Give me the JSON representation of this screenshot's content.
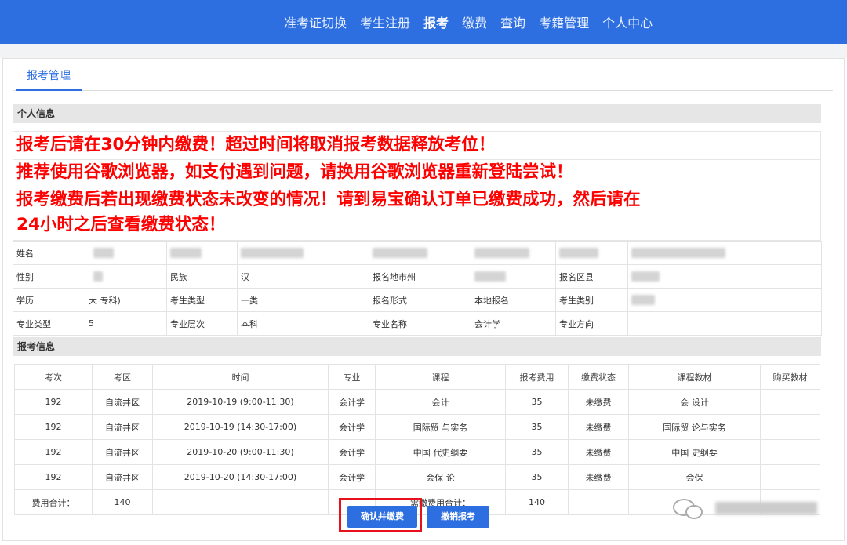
{
  "nav": {
    "items": [
      {
        "label": "准考证切换",
        "active": false
      },
      {
        "label": "考生注册",
        "active": false
      },
      {
        "label": "报考",
        "active": true
      },
      {
        "label": "缴费",
        "active": false
      },
      {
        "label": "查询",
        "active": false
      },
      {
        "label": "考籍管理",
        "active": false
      },
      {
        "label": "个人中心",
        "active": false
      }
    ]
  },
  "tab": {
    "label": "报考管理"
  },
  "personal": {
    "section_title": "个人信息",
    "notice": [
      "报考后请在30分钟内缴费！超过时间将取消报考数据释放考位！",
      "推荐使用谷歌浏览器，如支付遇到问题，请换用谷歌浏览器重新登陆尝试！",
      "报考缴费后若出现缴费状态未改变的情况！请到易宝确认订单已缴费成功，然后请在",
      "24小时之后查看缴费状态！"
    ],
    "fields": {
      "name_label": "姓名",
      "gender_label": "性别",
      "ethnicity_label": "民族",
      "ethnicity_value": "汉",
      "city_label": "报名地市州",
      "district_label": "报名区县",
      "education_label": "学历",
      "education_value": "大   专科)",
      "candidate_type_label": "考生类型",
      "candidate_type_value": "一类",
      "form_label": "报名形式",
      "form_value": "本地报名",
      "candidate_category_label": "考生类别",
      "major_type_label": "专业类型",
      "major_type_value": "5",
      "major_level_label": "专业层次",
      "major_level_value": "本科",
      "major_name_label": "专业名称",
      "major_name_value": "会计学",
      "major_direction_label": "专业方向"
    }
  },
  "exam": {
    "section_title": "报考信息",
    "headers": [
      "考次",
      "考区",
      "时间",
      "专业",
      "课程",
      "报考费用",
      "缴费状态",
      "课程教材",
      "购买教材"
    ],
    "rows": [
      {
        "session": "192",
        "area": "自流井区",
        "time": "2019-10-19 (9:00-11:30)",
        "major": "会计学",
        "course": "会计    ",
        "fee": "35",
        "status": "未缴费",
        "textbook": "会      设计"
      },
      {
        "session": "192",
        "area": "自流井区",
        "time": "2019-10-19 (14:30-17:00)",
        "major": "会计学",
        "course": "国际贸    与实务",
        "fee": "35",
        "status": "未缴费",
        "textbook": "国际贸    论与实务"
      },
      {
        "session": "192",
        "area": "自流井区",
        "time": "2019-10-20 (9:00-11:30)",
        "major": "会计学",
        "course": "中国    代史纲要",
        "fee": "35",
        "status": "未缴费",
        "textbook": "中国      史纲要"
      },
      {
        "session": "192",
        "area": "自流井区",
        "time": "2019-10-20 (14:30-17:00)",
        "major": "会计学",
        "course": "会保    论",
        "fee": "35",
        "status": "未缴费",
        "textbook": "会保"
      }
    ],
    "total_label": "费用合计：",
    "total_value": "140",
    "payable_label": "需缴费用合计：",
    "payable_value": "140"
  },
  "actions": {
    "confirm_label": "确认并缴费",
    "cancel_label": "撤销报考"
  },
  "colors": {
    "brand": "#2d6fe0",
    "notice_red": "#ff0000",
    "highlight_frame": "#e8101b"
  }
}
